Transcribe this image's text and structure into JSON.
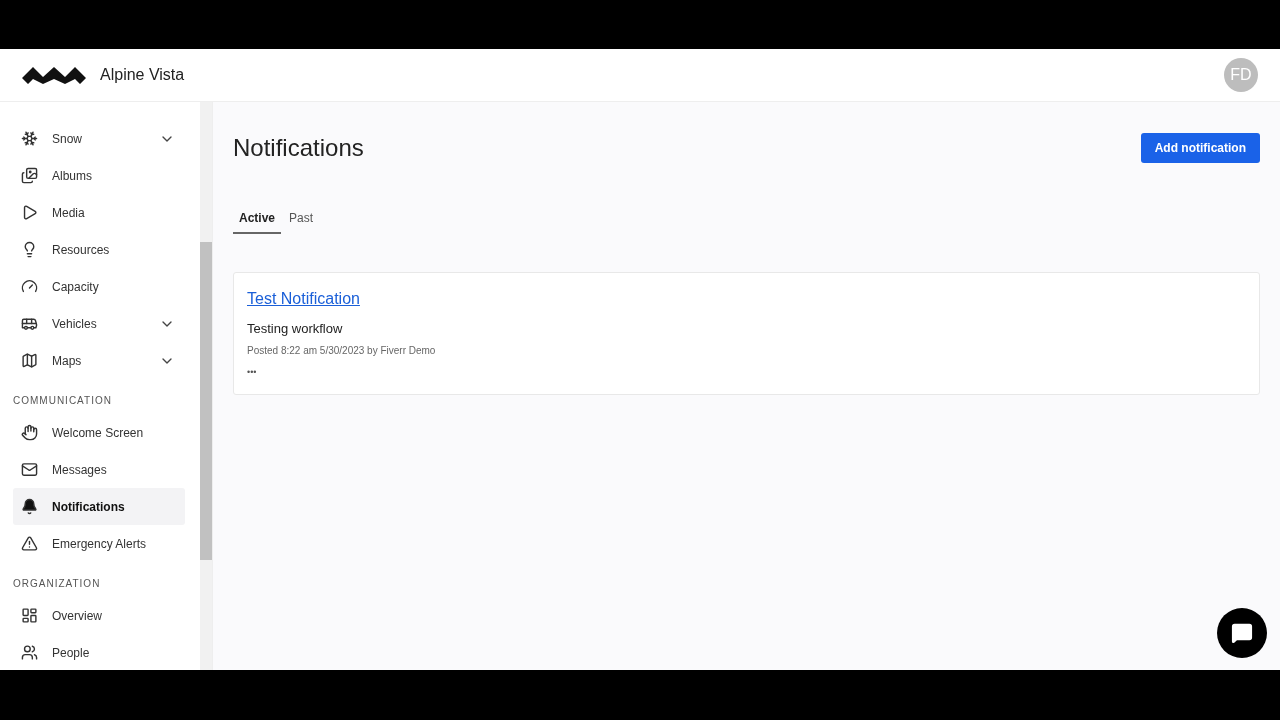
{
  "header": {
    "brand": "Alpine Vista",
    "avatar": "FD"
  },
  "sidebar": {
    "groups": [
      {
        "items": [
          {
            "label": "Snow",
            "has_submenu": true,
            "selected": false
          },
          {
            "label": "Albums",
            "has_submenu": false,
            "selected": false
          },
          {
            "label": "Media",
            "has_submenu": false,
            "selected": false
          },
          {
            "label": "Resources",
            "has_submenu": false,
            "selected": false
          },
          {
            "label": "Capacity",
            "has_submenu": false,
            "selected": false
          },
          {
            "label": "Vehicles",
            "has_submenu": true,
            "selected": false
          },
          {
            "label": "Maps",
            "has_submenu": true,
            "selected": false
          }
        ]
      },
      {
        "heading": "COMMUNICATION",
        "items": [
          {
            "label": "Welcome Screen",
            "has_submenu": false,
            "selected": false
          },
          {
            "label": "Messages",
            "has_submenu": false,
            "selected": false
          },
          {
            "label": "Notifications",
            "has_submenu": false,
            "selected": true
          },
          {
            "label": "Emergency Alerts",
            "has_submenu": false,
            "selected": false
          }
        ]
      },
      {
        "heading": "ORGANIZATION",
        "items": [
          {
            "label": "Overview",
            "has_submenu": false,
            "selected": false
          },
          {
            "label": "People",
            "has_submenu": false,
            "selected": false
          }
        ]
      }
    ]
  },
  "page": {
    "title": "Notifications",
    "add_button": "Add notification",
    "tabs": [
      {
        "label": "Active",
        "selected": true
      },
      {
        "label": "Past",
        "selected": false
      }
    ],
    "notifications": [
      {
        "title": "Test Notification",
        "body": "Testing workflow",
        "meta": "Posted 8:22 am 5/30/2023 by Fiverr Demo",
        "more": "•••"
      }
    ]
  }
}
